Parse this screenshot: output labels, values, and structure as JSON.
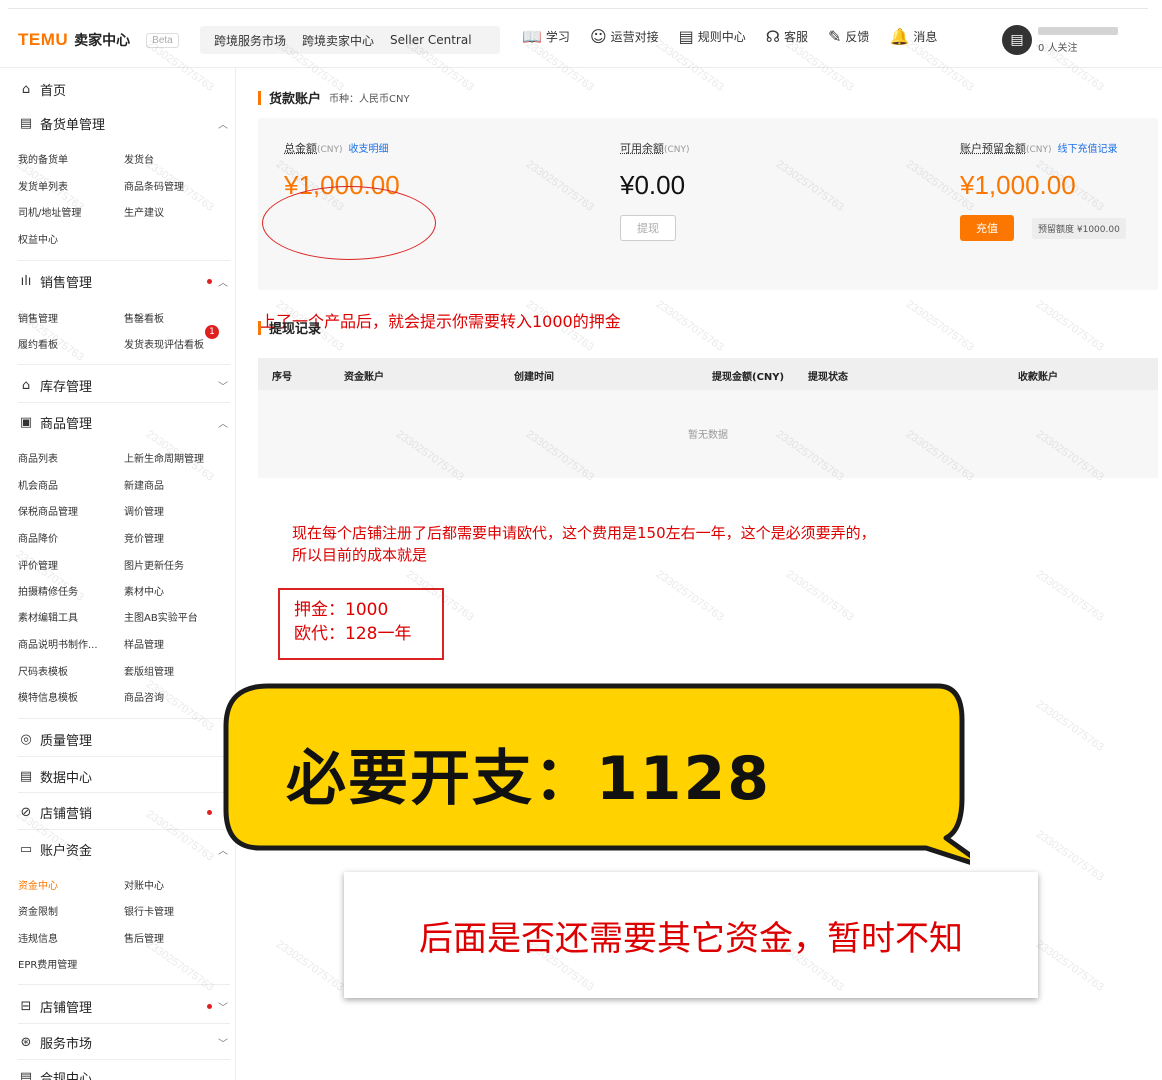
{
  "header": {
    "logo": "TEMU",
    "title": "卖家中心",
    "beta": "Beta",
    "nav_links": [
      "跨境服务市场",
      "跨境卖家中心",
      "Seller Central"
    ],
    "menu": [
      {
        "icon": "📖",
        "label": "学习"
      },
      {
        "icon": "☺",
        "label": "运营对接"
      },
      {
        "icon": "▤",
        "label": "规则中心"
      },
      {
        "icon": "☊",
        "label": "客服"
      },
      {
        "icon": "✎",
        "label": "反馈"
      },
      {
        "icon": "🔔",
        "label": "消息"
      }
    ],
    "followers": "0 人关注"
  },
  "sidebar": {
    "home": "首页",
    "sections": [
      {
        "label": "备货单管理",
        "items": [
          "我的备货单",
          "发货台",
          "发货单列表",
          "商品条码管理",
          "司机/地址管理",
          "生产建议",
          "权益中心"
        ]
      },
      {
        "label": "销售管理",
        "items": [
          "销售管理",
          "售罄看板",
          "履约看板",
          "发货表现评估看板"
        ],
        "badge": "1"
      },
      {
        "label": "库存管理"
      },
      {
        "label": "商品管理",
        "items": [
          "商品列表",
          "上新生命周期管理",
          "机会商品",
          "新建商品",
          "保税商品管理",
          "调价管理",
          "商品降价",
          "竞价管理",
          "评价管理",
          "图片更新任务",
          "拍摄精修任务",
          "素材中心",
          "素材编辑工具",
          "主图AB实验平台",
          "商品说明书制作...",
          "样品管理",
          "尺码表模板",
          "套版组管理",
          "模特信息模板",
          "商品咨询"
        ]
      },
      {
        "label": "质量管理"
      },
      {
        "label": "数据中心"
      },
      {
        "label": "店铺营销"
      },
      {
        "label": "账户资金",
        "items": [
          "资金中心",
          "对账中心",
          "资金限制",
          "银行卡管理",
          "违规信息",
          "售后管理",
          "EPR费用管理"
        ]
      },
      {
        "label": "店铺管理"
      },
      {
        "label": "服务市场"
      },
      {
        "label": "合规中心"
      }
    ]
  },
  "account": {
    "title": "货款账户",
    "currency": "币种：人民币CNY",
    "total_label": "总金额",
    "total_unit": "(CNY)",
    "total_link": "收支明细",
    "total_amount": "¥1,000.00",
    "avail_label": "可用余额",
    "avail_unit": "(CNY)",
    "avail_amount": "¥0.00",
    "withdraw_btn": "提现",
    "reserve_label": "账户预留金额",
    "reserve_unit": "(CNY)",
    "reserve_link": "线下充值记录",
    "reserve_amount": "¥1,000.00",
    "recharge_btn": "充值",
    "reserve_limit": "预留额度 ¥1000.00"
  },
  "withdraw": {
    "title": "提现记录",
    "columns": [
      "序号",
      "资金账户",
      "创建时间",
      "提现金额(CNY)",
      "提现状态",
      "收款账户"
    ],
    "empty": "暂无数据"
  },
  "annotations": {
    "note1": "上了一个产品后，就会提示你需要转入1000的押金",
    "note2_line1": "现在每个店铺注册了后都需要申请欧代，这个费用是150左右一年，这个是必须要弄的，",
    "note2_line2": "所以目前的成本就是",
    "box_line1": "押金：1000",
    "box_line2": "欧代：128一年",
    "bubble": "必要开支：1128",
    "bottom": "后面是否还需要其它资金，暂时不知"
  },
  "watermark": "2330257075763"
}
